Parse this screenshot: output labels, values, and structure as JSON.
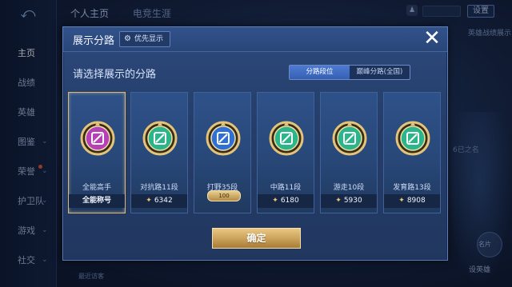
{
  "background": {
    "back_icon": "back-arrow-icon",
    "top_tabs": [
      "个人主页",
      "电竞生涯"
    ],
    "top_right_button": "设置",
    "top_right_label": "英雄战绩展示",
    "nav_items": [
      {
        "label": "主页",
        "active": true
      },
      {
        "label": "战绩"
      },
      {
        "label": "英雄"
      },
      {
        "label": "图鉴",
        "chevron": true
      },
      {
        "label": "荣誉",
        "chevron": true,
        "badge": true
      },
      {
        "label": "护卫队",
        "chevron": true
      },
      {
        "label": "游戏",
        "chevron": true
      },
      {
        "label": "社交",
        "chevron": true
      }
    ],
    "right_text": "6已之名",
    "bottom_right_label": "设英雄",
    "bottom_right_small": "名片",
    "bottom_left_text": "最近访客"
  },
  "modal": {
    "title": "展示分路",
    "priority_label": "优先显示",
    "prompt": "请选择展示的分路",
    "segments": [
      "分路段位",
      "巅峰分路(全国)"
    ],
    "active_segment": 0,
    "confirm_label": "确定",
    "cards": [
      {
        "name": "全能高手",
        "footer": "全能称号",
        "selected": true,
        "emblem_color": "#b640b8",
        "emblem_icon": "allround-icon"
      },
      {
        "name": "对抗路11段",
        "score": "6342",
        "emblem_color": "#2bb58a",
        "emblem_icon": "clash-lane-icon"
      },
      {
        "name": "打野35段",
        "medal": "100",
        "emblem_color": "#2f6fd8",
        "emblem_icon": "jungle-icon"
      },
      {
        "name": "中路11段",
        "score": "6180",
        "emblem_color": "#2bb58a",
        "emblem_icon": "mid-lane-icon"
      },
      {
        "name": "游走10段",
        "score": "5930",
        "emblem_color": "#2bb58a",
        "emblem_icon": "roam-icon"
      },
      {
        "name": "发育路13段",
        "score": "8908",
        "emblem_color": "#2bb58a",
        "emblem_icon": "farm-lane-icon"
      }
    ]
  }
}
